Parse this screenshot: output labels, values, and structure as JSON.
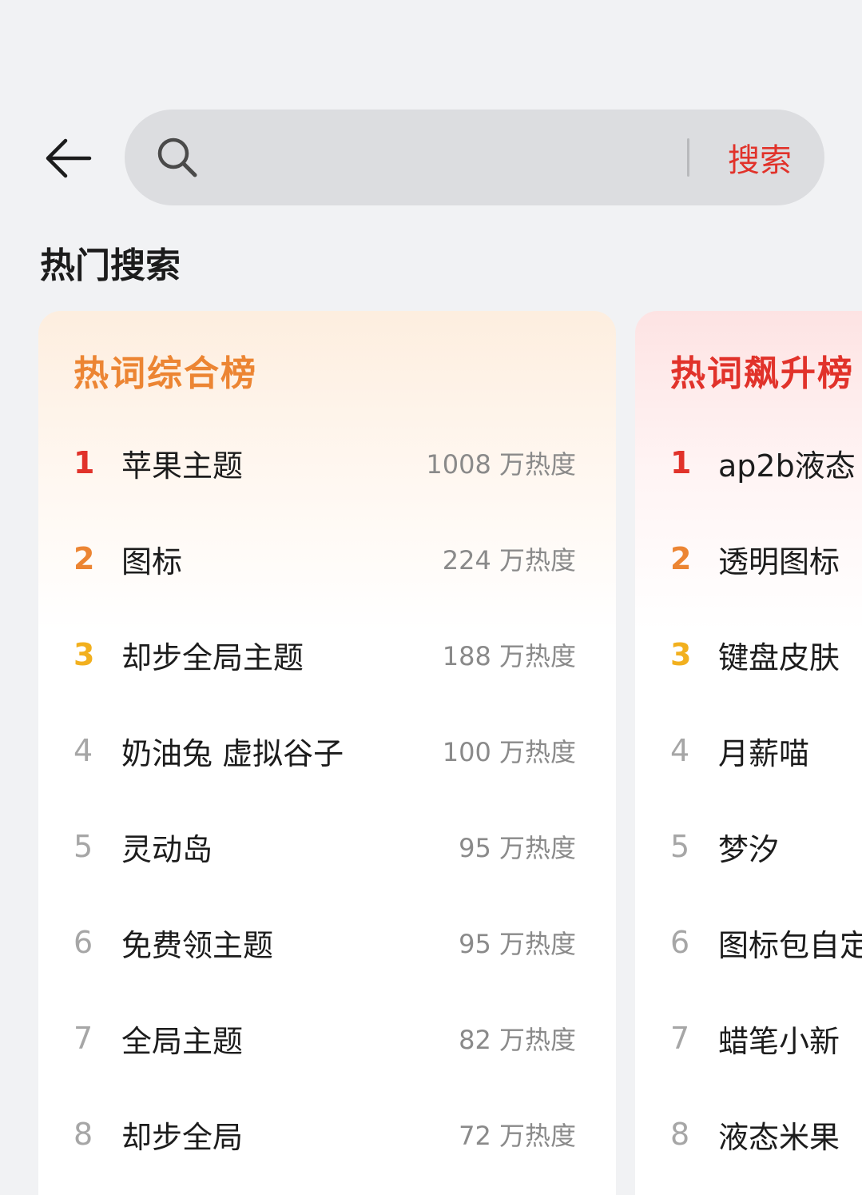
{
  "search": {
    "placeholder": "",
    "button_label": "搜索"
  },
  "section_title": "热门搜索",
  "colors": {
    "accent_red": "#e1322a",
    "accent_orange": "#ec8533",
    "accent_yellow": "#f2b01e"
  },
  "boards": [
    {
      "title": "热词综合榜",
      "items": [
        {
          "rank": "1",
          "term": "苹果主题",
          "heat": "1008 万热度"
        },
        {
          "rank": "2",
          "term": "图标",
          "heat": "224 万热度"
        },
        {
          "rank": "3",
          "term": "却步全局主题",
          "heat": "188 万热度"
        },
        {
          "rank": "4",
          "term": "奶油兔 虚拟谷子",
          "heat": "100 万热度"
        },
        {
          "rank": "5",
          "term": "灵动岛",
          "heat": "95 万热度"
        },
        {
          "rank": "6",
          "term": "免费领主题",
          "heat": "95 万热度"
        },
        {
          "rank": "7",
          "term": "全局主题",
          "heat": "82 万热度"
        },
        {
          "rank": "8",
          "term": "却步全局",
          "heat": "72 万热度"
        }
      ]
    },
    {
      "title": "热词飙升榜",
      "items": [
        {
          "rank": "1",
          "term": "ap2b液态"
        },
        {
          "rank": "2",
          "term": "透明图标"
        },
        {
          "rank": "3",
          "term": "键盘皮肤"
        },
        {
          "rank": "4",
          "term": "月薪喵"
        },
        {
          "rank": "5",
          "term": "梦汐"
        },
        {
          "rank": "6",
          "term": "图标包自定"
        },
        {
          "rank": "7",
          "term": "蜡笔小新"
        },
        {
          "rank": "8",
          "term": "液态米果"
        }
      ]
    }
  ]
}
